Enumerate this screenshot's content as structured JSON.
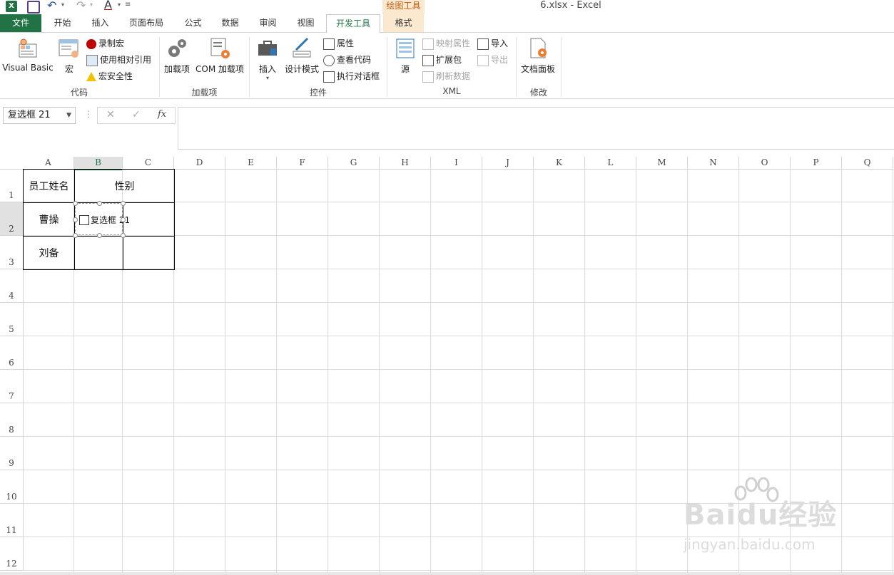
{
  "window": {
    "title": "6.xlsx - Excel",
    "context_group_label": "绘图工具"
  },
  "tabs": [
    {
      "id": "file",
      "label": "文件"
    },
    {
      "id": "home",
      "label": "开始"
    },
    {
      "id": "insert",
      "label": "插入"
    },
    {
      "id": "layout",
      "label": "页面布局"
    },
    {
      "id": "formulas",
      "label": "公式"
    },
    {
      "id": "data",
      "label": "数据"
    },
    {
      "id": "review",
      "label": "审阅"
    },
    {
      "id": "view",
      "label": "视图"
    },
    {
      "id": "developer",
      "label": "开发工具"
    },
    {
      "id": "format",
      "label": "格式"
    }
  ],
  "ribbon": {
    "code": {
      "label": "代码",
      "visual_basic": "Visual Basic",
      "macros": "宏",
      "record_macro": "录制宏",
      "relative_refs": "使用相对引用",
      "macro_security": "宏安全性"
    },
    "addins": {
      "label": "加载项",
      "addins": "加载项",
      "com_addins": "COM 加载项"
    },
    "controls": {
      "label": "控件",
      "insert": "插入",
      "design_mode": "设计模式",
      "properties": "属性",
      "view_code": "查看代码",
      "run_dialog": "执行对话框"
    },
    "xml": {
      "label": "XML",
      "source": "源",
      "map_properties": "映射属性",
      "expansion_packs": "扩展包",
      "refresh_data": "刷新数据",
      "import": "导入",
      "export": "导出"
    },
    "modify": {
      "label": "修改",
      "document_panel": "文档面板"
    }
  },
  "formula_bar": {
    "name_box": "复选框 21",
    "fx": "fx",
    "formula": ""
  },
  "columns": [
    "A",
    "B",
    "C",
    "D",
    "E",
    "F",
    "G",
    "H",
    "I",
    "J",
    "K",
    "L",
    "M",
    "N",
    "O",
    "P",
    "Q"
  ],
  "rows": [
    "1",
    "2",
    "3",
    "4",
    "5",
    "6",
    "7",
    "8",
    "9",
    "10",
    "11",
    "12"
  ],
  "cells": {
    "A1": "员工姓名",
    "B1": "性别",
    "A2": "曹操",
    "A3": "刘备"
  },
  "checkbox": {
    "label": "复选框 21",
    "checked": false
  },
  "watermark": {
    "line1": "Baidu经验",
    "line2": "jingyan.baidu.com"
  },
  "colors": {
    "accent": "#217346",
    "context": "#fbe9cf",
    "context_text": "#c55a11"
  }
}
